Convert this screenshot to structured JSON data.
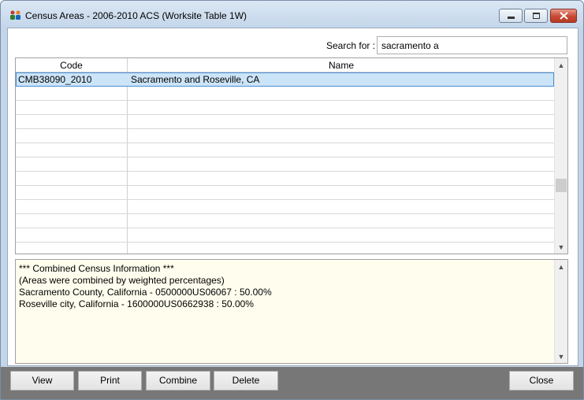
{
  "window": {
    "title": "Census Areas - 2006-2010 ACS (Worksite Table 1W)",
    "app_icon": "census-people-icon"
  },
  "search": {
    "label": "Search for :",
    "value": "sacramento a"
  },
  "grid": {
    "columns": [
      "Code",
      "Name"
    ],
    "rows": [
      {
        "code": "CMB38090_2010",
        "name": "Sacramento and Roseville, CA",
        "selected": true
      }
    ],
    "selection_color": "#cce4f7"
  },
  "info": {
    "lines": [
      "*** Combined Census Information ***",
      "(Areas were combined by weighted percentages)",
      "Sacramento County, California - 0500000US06067 : 50.00%",
      "Roseville city, California - 1600000US0662938 : 50.00%"
    ],
    "background": "#fffeee"
  },
  "buttons": {
    "view": "View",
    "print": "Print",
    "combine": "Combine",
    "delete": "Delete",
    "close": "Close"
  }
}
